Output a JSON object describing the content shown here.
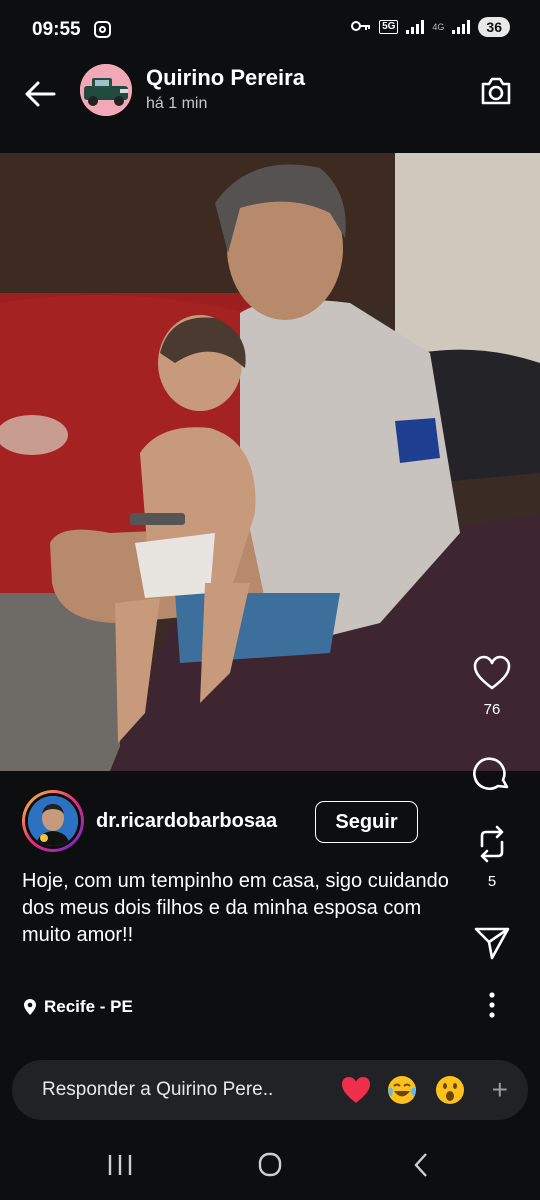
{
  "status_bar": {
    "time": "09:55",
    "net_5g": "5G",
    "net_4g": "4G",
    "battery": "36"
  },
  "header": {
    "username": "Quirino Pereira",
    "timestamp": "há 1 min"
  },
  "actions": {
    "likes": "76",
    "reposts": "5"
  },
  "post": {
    "author": "dr.ricardobarbosaa",
    "follow_label": "Seguir",
    "caption": "Hoje, com um tempinho em casa, sigo cuidando dos meus dois filhos e da minha esposa com muito amor!!",
    "location": "Recife - PE"
  },
  "reply": {
    "placeholder": "Responder a Quirino Pere.."
  },
  "colors": {
    "background": "#0d0e10",
    "reply_bar": "#202226",
    "avatar_bg": "#f3a8b8"
  }
}
